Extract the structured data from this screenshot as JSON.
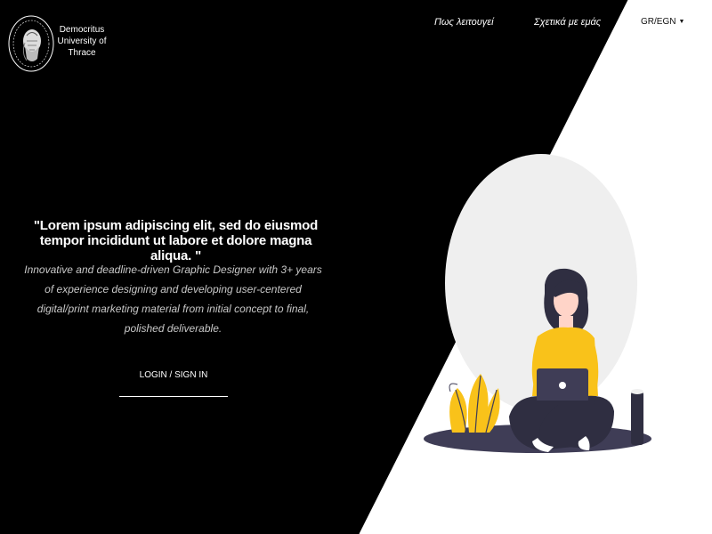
{
  "brand": {
    "logo_icon": "university-seal-icon",
    "name": "Democritus University of Thrace"
  },
  "nav": {
    "how_it_works": "Πως λειτουγεί",
    "about_us": "Σχετικά με εμάς",
    "language": "GR/EGN",
    "language_caret_icon": "caret-down-icon"
  },
  "hero": {
    "quote": "\"Lorem ipsum adipiscing elit, sed do eiusmod tempor incididunt ut labore et dolore magna aliqua. \"",
    "description": "Innovative and deadline-driven Graphic Designer with 3+ years of experience designing and developing user-centered digital/print marketing material from initial concept to final, polished deliverable.",
    "login_label": "LOGIN / SIGN IN"
  },
  "illustration": {
    "name": "woman-with-laptop-illustration",
    "accent": "#f9c21a",
    "dark": "#3f3d56"
  },
  "colors": {
    "background_dark": "#000000",
    "background_light": "#ffffff"
  }
}
